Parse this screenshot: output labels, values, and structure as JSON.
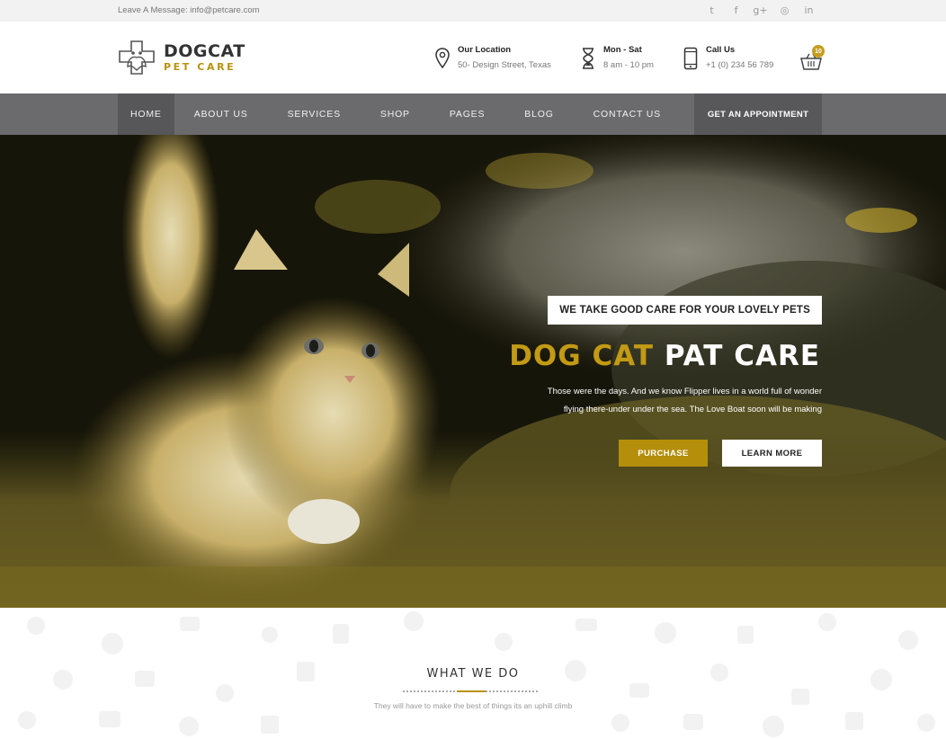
{
  "topbar": {
    "message": "Leave A Message: info@petcare.com",
    "social": [
      {
        "icon": "twitter-icon",
        "glyph": "t"
      },
      {
        "icon": "facebook-icon",
        "glyph": "f"
      },
      {
        "icon": "google-plus-icon",
        "glyph": "g+"
      },
      {
        "icon": "dribbble-icon",
        "glyph": "◎"
      },
      {
        "icon": "linkedin-icon",
        "glyph": "in"
      }
    ]
  },
  "brand": {
    "name": "DOGCAT",
    "tagline": "PET CARE",
    "accent": "#b8920a"
  },
  "header_info": {
    "location": {
      "title": "Our Location",
      "detail": "50- Design Street, Texas",
      "icon": "map-pin-icon"
    },
    "hours": {
      "title": "Mon - Sat",
      "detail": "8 am - 10 pm",
      "icon": "hourglass-icon"
    },
    "call": {
      "title": "Call Us",
      "detail": "+1 (0) 234 56 789",
      "icon": "phone-icon"
    }
  },
  "cart": {
    "count": "10",
    "icon": "basket-icon"
  },
  "nav": {
    "items": [
      "HOME",
      "ABOUT US",
      "SERVICES",
      "SHOP",
      "PAGES",
      "BLOG",
      "CONTACT US"
    ],
    "active": "HOME",
    "cta": "GET AN APPOINTMENT"
  },
  "hero": {
    "tag": "WE TAKE GOOD CARE FOR YOUR LOVELY PETS",
    "title_gold": "DOG CAT",
    "title_white": "PAT CARE",
    "line1": "Those were the days. And we know Flipper lives in a world full of wonder",
    "line2": "flying there-under under the sea. The Love Boat soon will be making",
    "purchase": "PURCHASE",
    "learn_more": "LEARN MORE"
  },
  "section": {
    "title": "WHAT WE DO",
    "subtitle": "They will have to make the best of things its an uphill climb"
  }
}
